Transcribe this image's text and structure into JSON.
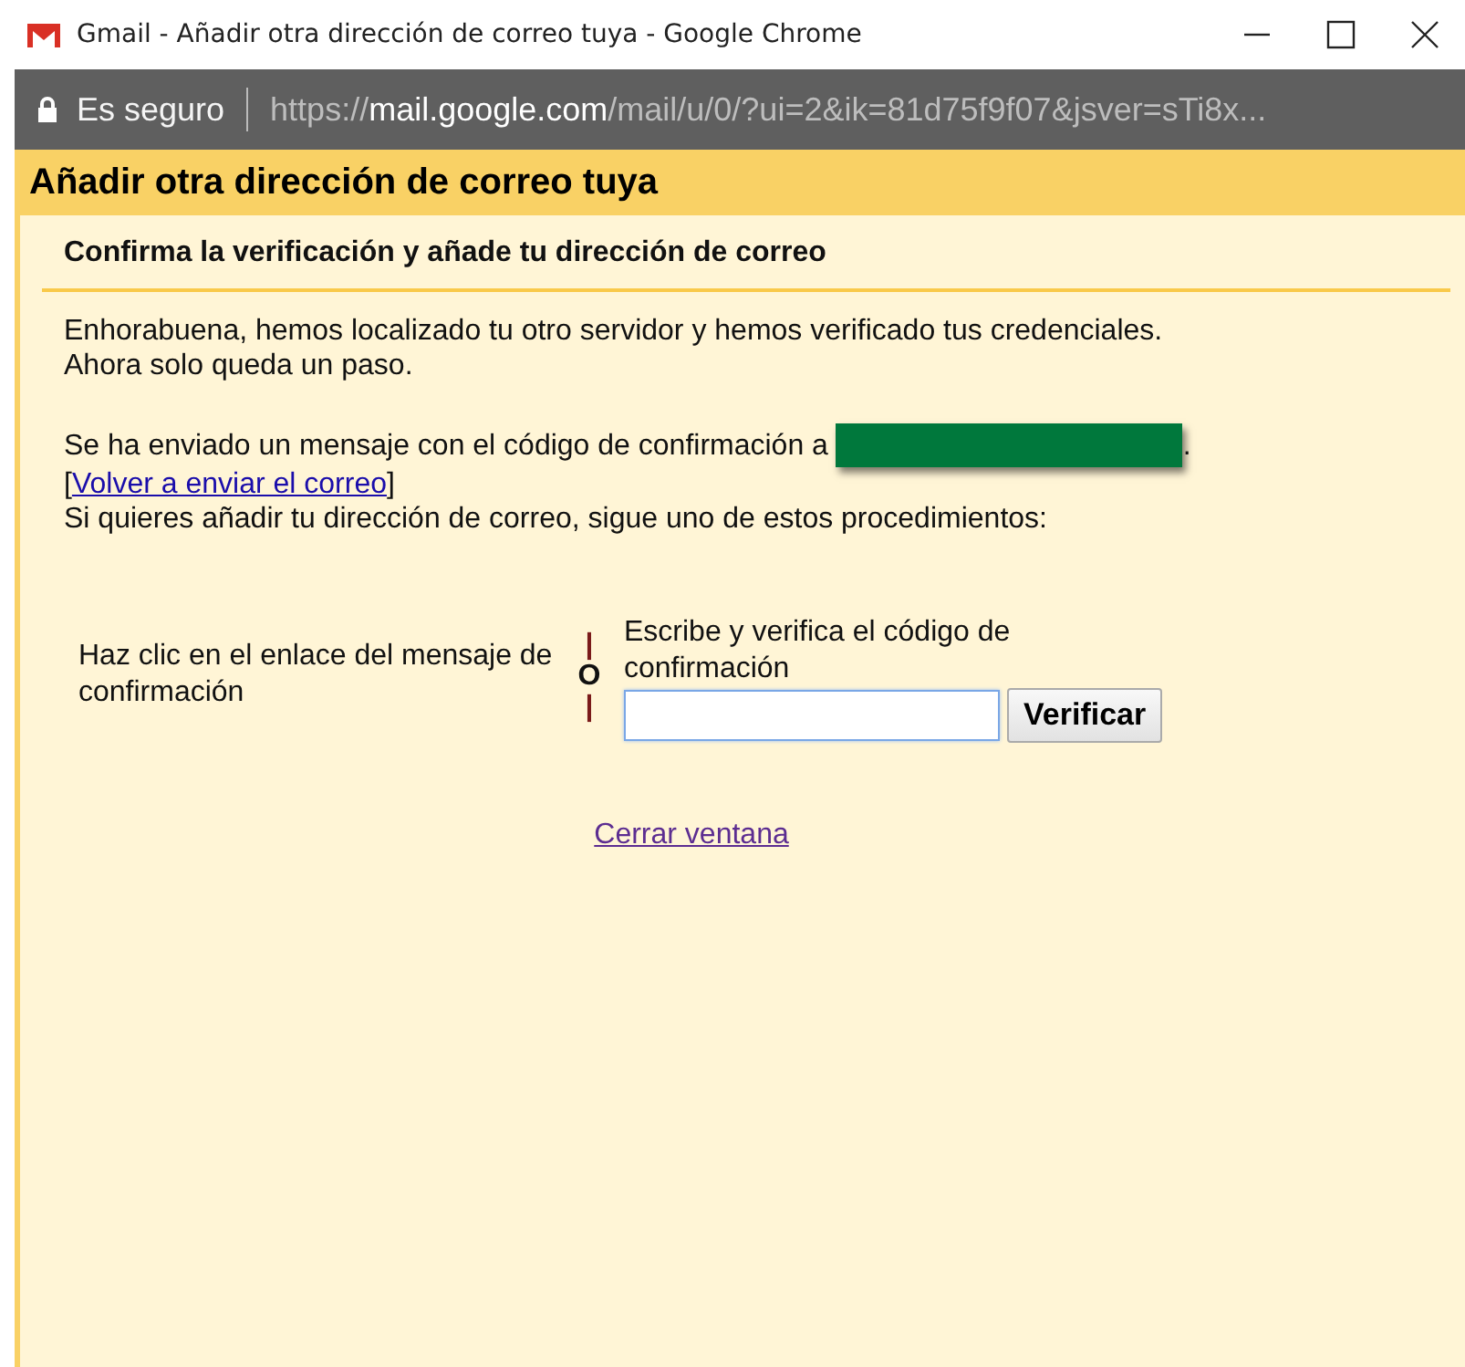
{
  "window": {
    "title": "Gmail - Añadir otra dirección de correo tuya - Google Chrome"
  },
  "address_bar": {
    "security": "Es seguro",
    "url_scheme": "https://",
    "url_host": "mail.google.com",
    "url_path": "/mail/u/0/?ui=2&ik=81d75f9f07&jsver=sTi8x..."
  },
  "dialog": {
    "title": "Añadir otra dirección de correo tuya",
    "subtitle": "Confirma la verificación y añade tu dirección de correo",
    "intro": [
      "Enhorabuena, hemos localizado tu otro servidor y hemos verificado tus credenciales.",
      "Ahora solo queda un paso."
    ],
    "sent_message": "Se ha enviado un mensaje con el código de confirmación a",
    "sent_end": ".",
    "resend_open": "[",
    "resend_link": "Volver a enviar el correo",
    "resend_close": "]",
    "instructions": "Si quieres añadir tu dirección de correo, sigue uno de estos procedimientos:",
    "option_link": "Haz clic en el enlace del mensaje de confirmación",
    "separator": [
      "|",
      "O",
      "|"
    ],
    "option_code": "Escribe y verifica el código de confirmación",
    "verify_button": "Verificar",
    "close_link": "Cerrar ventana"
  }
}
